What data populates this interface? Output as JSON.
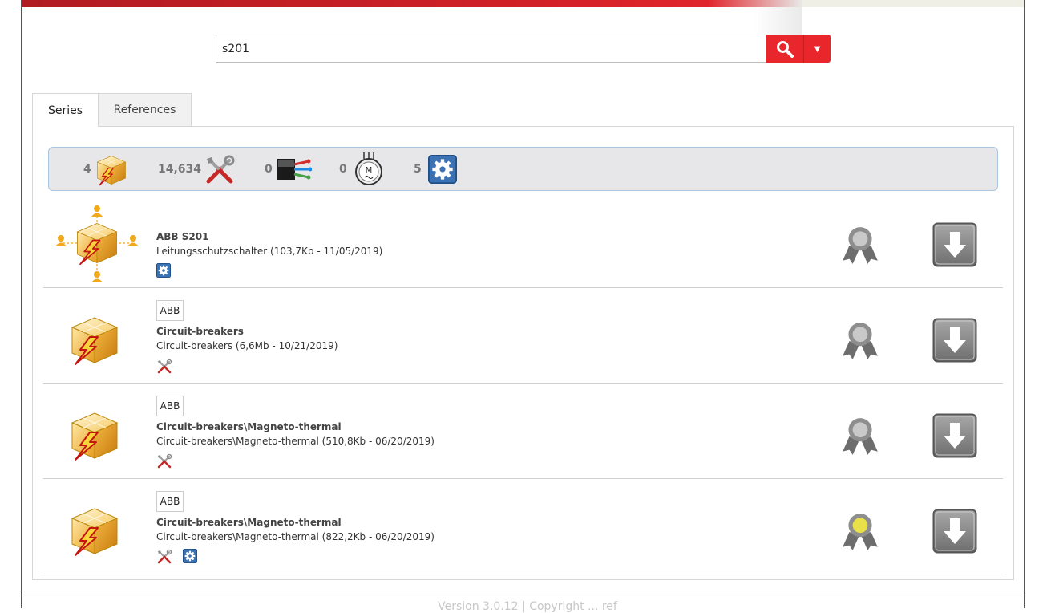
{
  "search": {
    "value": "s201"
  },
  "tabs": [
    {
      "label": "Series",
      "active": true
    },
    {
      "label": "References",
      "active": false
    }
  ],
  "summary": [
    {
      "count": "4",
      "icon": "series-cube-icon"
    },
    {
      "count": "14,634",
      "icon": "tools-icon"
    },
    {
      "count": "0",
      "icon": "cable-icon"
    },
    {
      "count": "0",
      "icon": "motor-icon"
    },
    {
      "count": "5",
      "icon": "config-gear-icon"
    }
  ],
  "results": [
    {
      "vendor": "",
      "title": "ABB S201",
      "subtitle": "Leitungsschutzschalter (103,7Kb - 11/05/2019)",
      "icons": [
        "config-gear-icon"
      ],
      "award": "gray"
    },
    {
      "vendor": "ABB",
      "title": "Circuit-breakers",
      "subtitle": "Circuit-breakers (6,6Mb - 10/21/2019)",
      "icons": [
        "tools-icon"
      ],
      "award": "gray"
    },
    {
      "vendor": "ABB",
      "title": "Circuit-breakers\\Magneto-thermal",
      "subtitle": "Circuit-breakers\\Magneto-thermal (510,8Kb - 06/20/2019)",
      "icons": [
        "tools-icon"
      ],
      "award": "gray"
    },
    {
      "vendor": "ABB",
      "title": "Circuit-breakers\\Magneto-thermal",
      "subtitle": "Circuit-breakers\\Magneto-thermal (822,2Kb - 06/20/2019)",
      "icons": [
        "tools-icon",
        "config-gear-icon"
      ],
      "award": "gold"
    }
  ],
  "colors": {
    "accent": "#e8262b",
    "award_gold": "#e9e04a",
    "award_gray": "#a9a9a9"
  },
  "footer": {
    "text": "Version 3.0.12 | Copyright ... ref"
  }
}
